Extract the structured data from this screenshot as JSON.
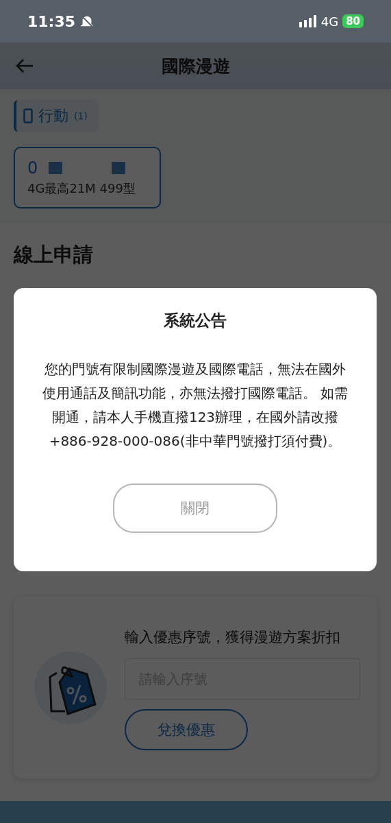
{
  "status_bar": {
    "time": "11:35",
    "network": "4G",
    "battery": "80"
  },
  "header": {
    "title": "國際漫遊"
  },
  "tabs": [
    {
      "label": "行動",
      "count": "(1)",
      "selected": true
    }
  ],
  "lines": [
    {
      "number": "0",
      "plan": "4G最高21M 499型",
      "selected": true
    }
  ],
  "section_title": "線上申請",
  "promo": {
    "text": "輸入優惠序號，獲得漫遊方案折扣",
    "placeholder": "請輸入序號",
    "button": "兌換優惠"
  },
  "dialog": {
    "title": "系統公告",
    "message": "您的門號有限制國際漫遊及國際電話，無法在國外使用通話及簡訊功能，亦無法撥打國際電話。 如需開通，請本人手機直撥123辦理，在國外請改撥+886-928-000-086(非中華門號撥打須付費)。",
    "button": "關閉"
  }
}
